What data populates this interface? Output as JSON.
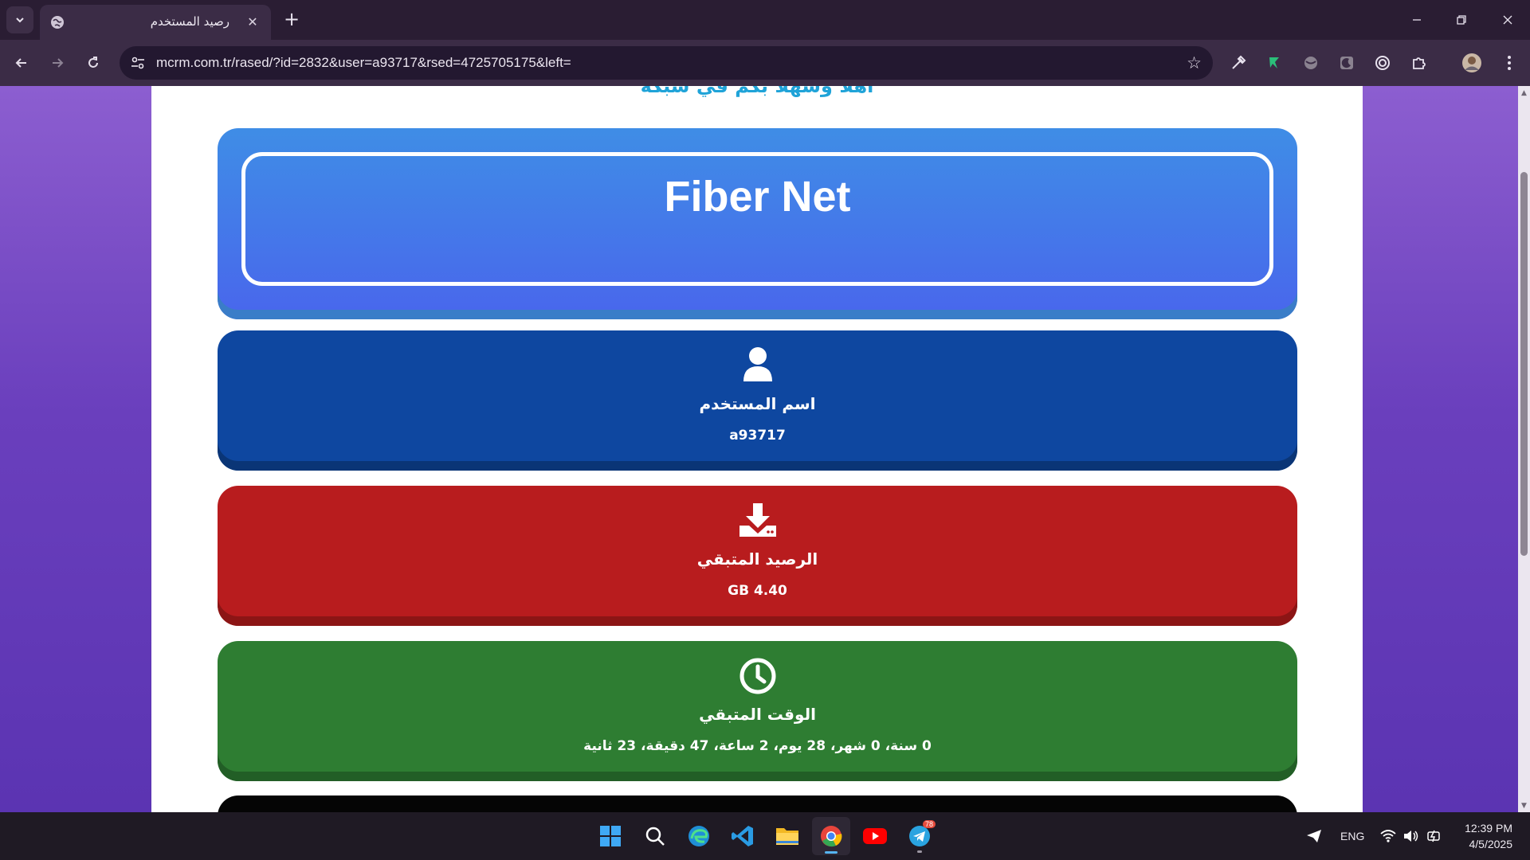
{
  "browser": {
    "tab_title": "رصيد المستخدم",
    "url": "mcrm.com.tr/rased/?id=2832&user=a93717&rsed=4725705175&left=",
    "new_tab_label": "+",
    "close_tab_label": "✕"
  },
  "page": {
    "cut_heading": "أهلا وسهلا بكم في شبكة",
    "header_title": "Fiber Net",
    "user": {
      "label": "اسم المستخدم",
      "value": "a93717",
      "color": "#0e47a0"
    },
    "balance": {
      "label": "الرصيد المتبقي",
      "value": "GB 4.40",
      "color": "#b81c1e"
    },
    "time": {
      "label": "الوقت المتبقي",
      "value": "0 سنة، 0 شهر، 28 يوم، 2 ساعة، 47 دقيقة، 23 ثانية",
      "color": "#2e7d32"
    }
  },
  "taskbar": {
    "language": "ENG",
    "time": "12:39 PM",
    "date": "4/5/2025",
    "telegram_badge": "78",
    "apps": [
      "start-icon",
      "search-icon",
      "edge-icon",
      "vscode-icon",
      "file-explorer-icon",
      "chrome-icon",
      "youtube-icon",
      "telegram-icon"
    ]
  }
}
